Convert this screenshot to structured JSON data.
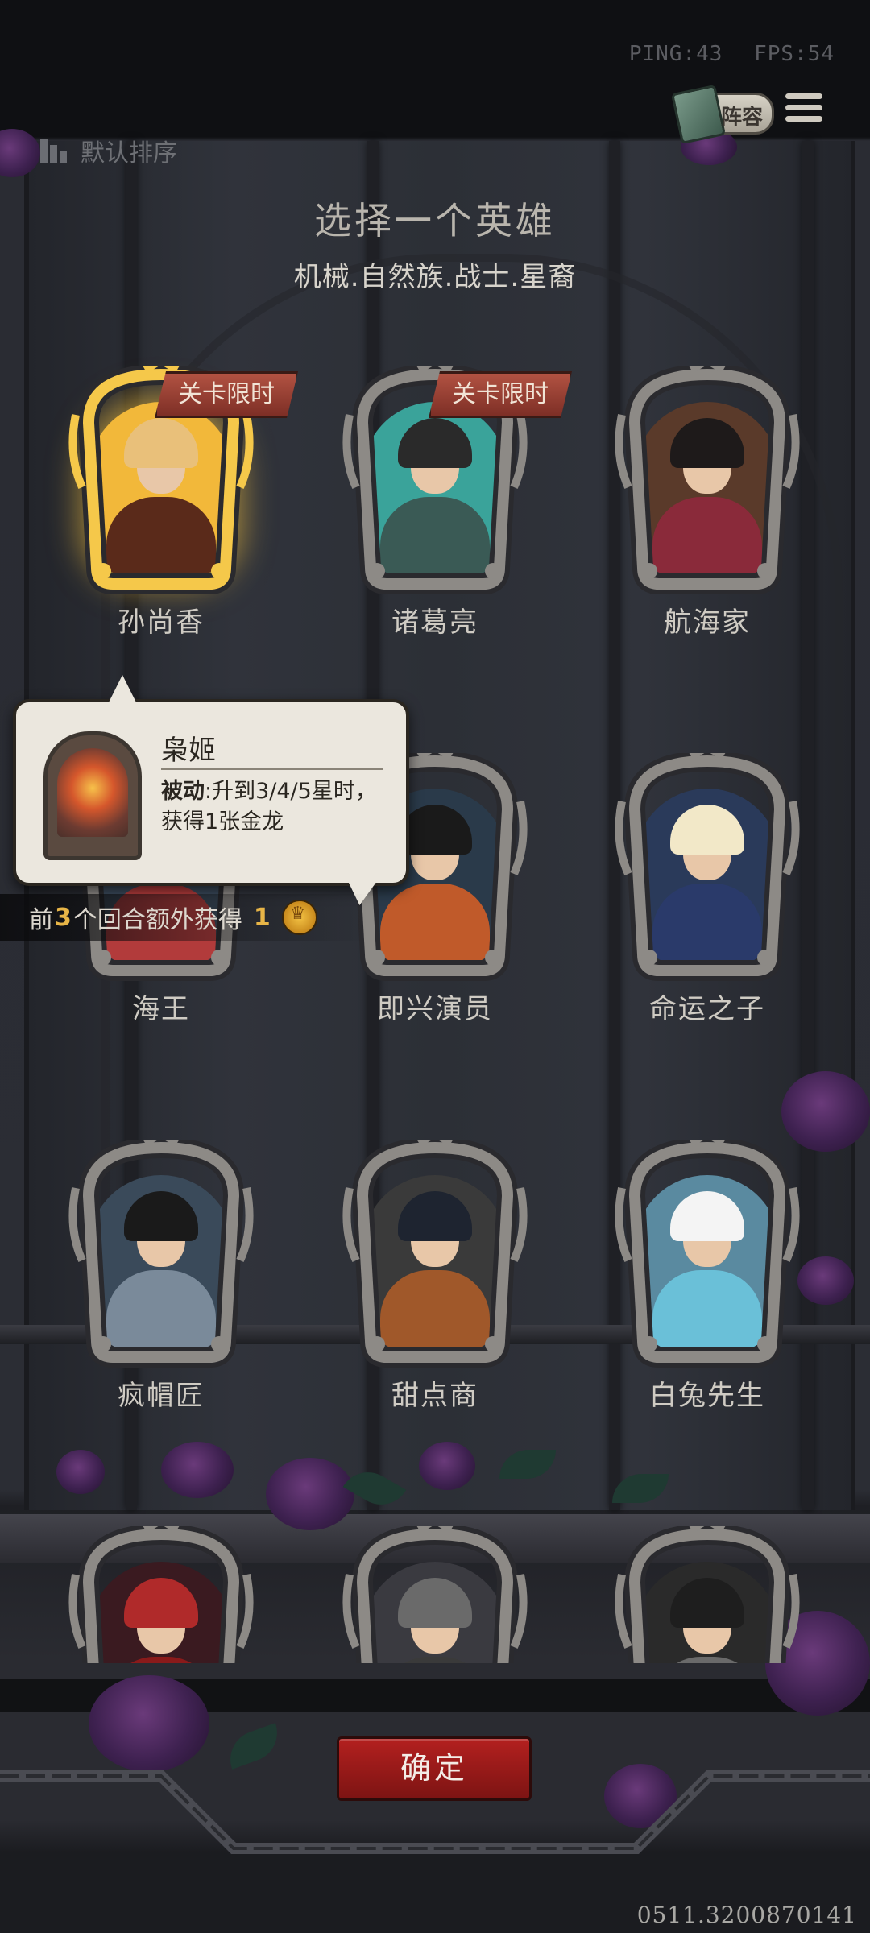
{
  "status": {
    "ping": "PING:43",
    "fps": "FPS:54"
  },
  "header": {
    "team_label": "阵容",
    "sort_label": "默认排序"
  },
  "selection": {
    "title": "选择一个英雄",
    "subtitle": "机械.自然族.战士.星裔"
  },
  "heroes": [
    {
      "name": "孙尚香",
      "badge": "关卡限时",
      "selected": true
    },
    {
      "name": "诸葛亮",
      "badge": "关卡限时"
    },
    {
      "name": "航海家"
    },
    {
      "name": "海王"
    },
    {
      "name": "即兴演员"
    },
    {
      "name": "命运之子"
    },
    {
      "name": "疯帽匠"
    },
    {
      "name": "甜点商"
    },
    {
      "name": "白兔先生"
    },
    {
      "name": ""
    },
    {
      "name": ""
    },
    {
      "name": ""
    }
  ],
  "tooltip": {
    "title": "枭姬",
    "desc_label": "被动",
    "desc_text": ":升到3/4/5星时，获得1张金龙"
  },
  "bonus": {
    "prefix": "前",
    "rounds": "3",
    "middle": "个回合额外获得",
    "amount": "1",
    "icon": "crown-coin-icon"
  },
  "confirm_label": "确定",
  "coordinates": "0511.3200870141",
  "colors": {
    "accent_red": "#9c1b1a",
    "badge_red": "#a24637",
    "gold": "#e8b547"
  }
}
